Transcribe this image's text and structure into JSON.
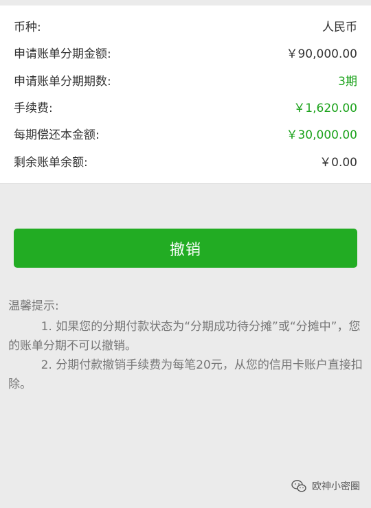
{
  "details": {
    "rows": [
      {
        "label": "币种:",
        "value": "人民币"
      },
      {
        "label": "申请账单分期金额:",
        "value": "￥90,000.00"
      },
      {
        "label": "申请账单分期期数:",
        "value": "3期"
      },
      {
        "label": "手续费:",
        "value": "￥1,620.00"
      },
      {
        "label": "每期偿还本金额:",
        "value": "￥30,000.00"
      },
      {
        "label": "剩余账单余额:",
        "value": "￥0.00"
      }
    ]
  },
  "actions": {
    "cancel_label": "撤销"
  },
  "tips": {
    "title": "温馨提示:",
    "items": [
      "1. 如果您的分期付款状态为“分期成功待分摊”或“分摊中”，您的账单分期不可以撤销。",
      "2. 分期付款撤销手续费为每笔20元，从您的信用卡账户直接扣除。"
    ]
  },
  "watermark": {
    "text": "欧神小密圈",
    "icon": "wechat-icon"
  },
  "colors": {
    "accent_green": "#22ac23",
    "value_green": "#1aa21a",
    "background": "#ebebeb"
  }
}
